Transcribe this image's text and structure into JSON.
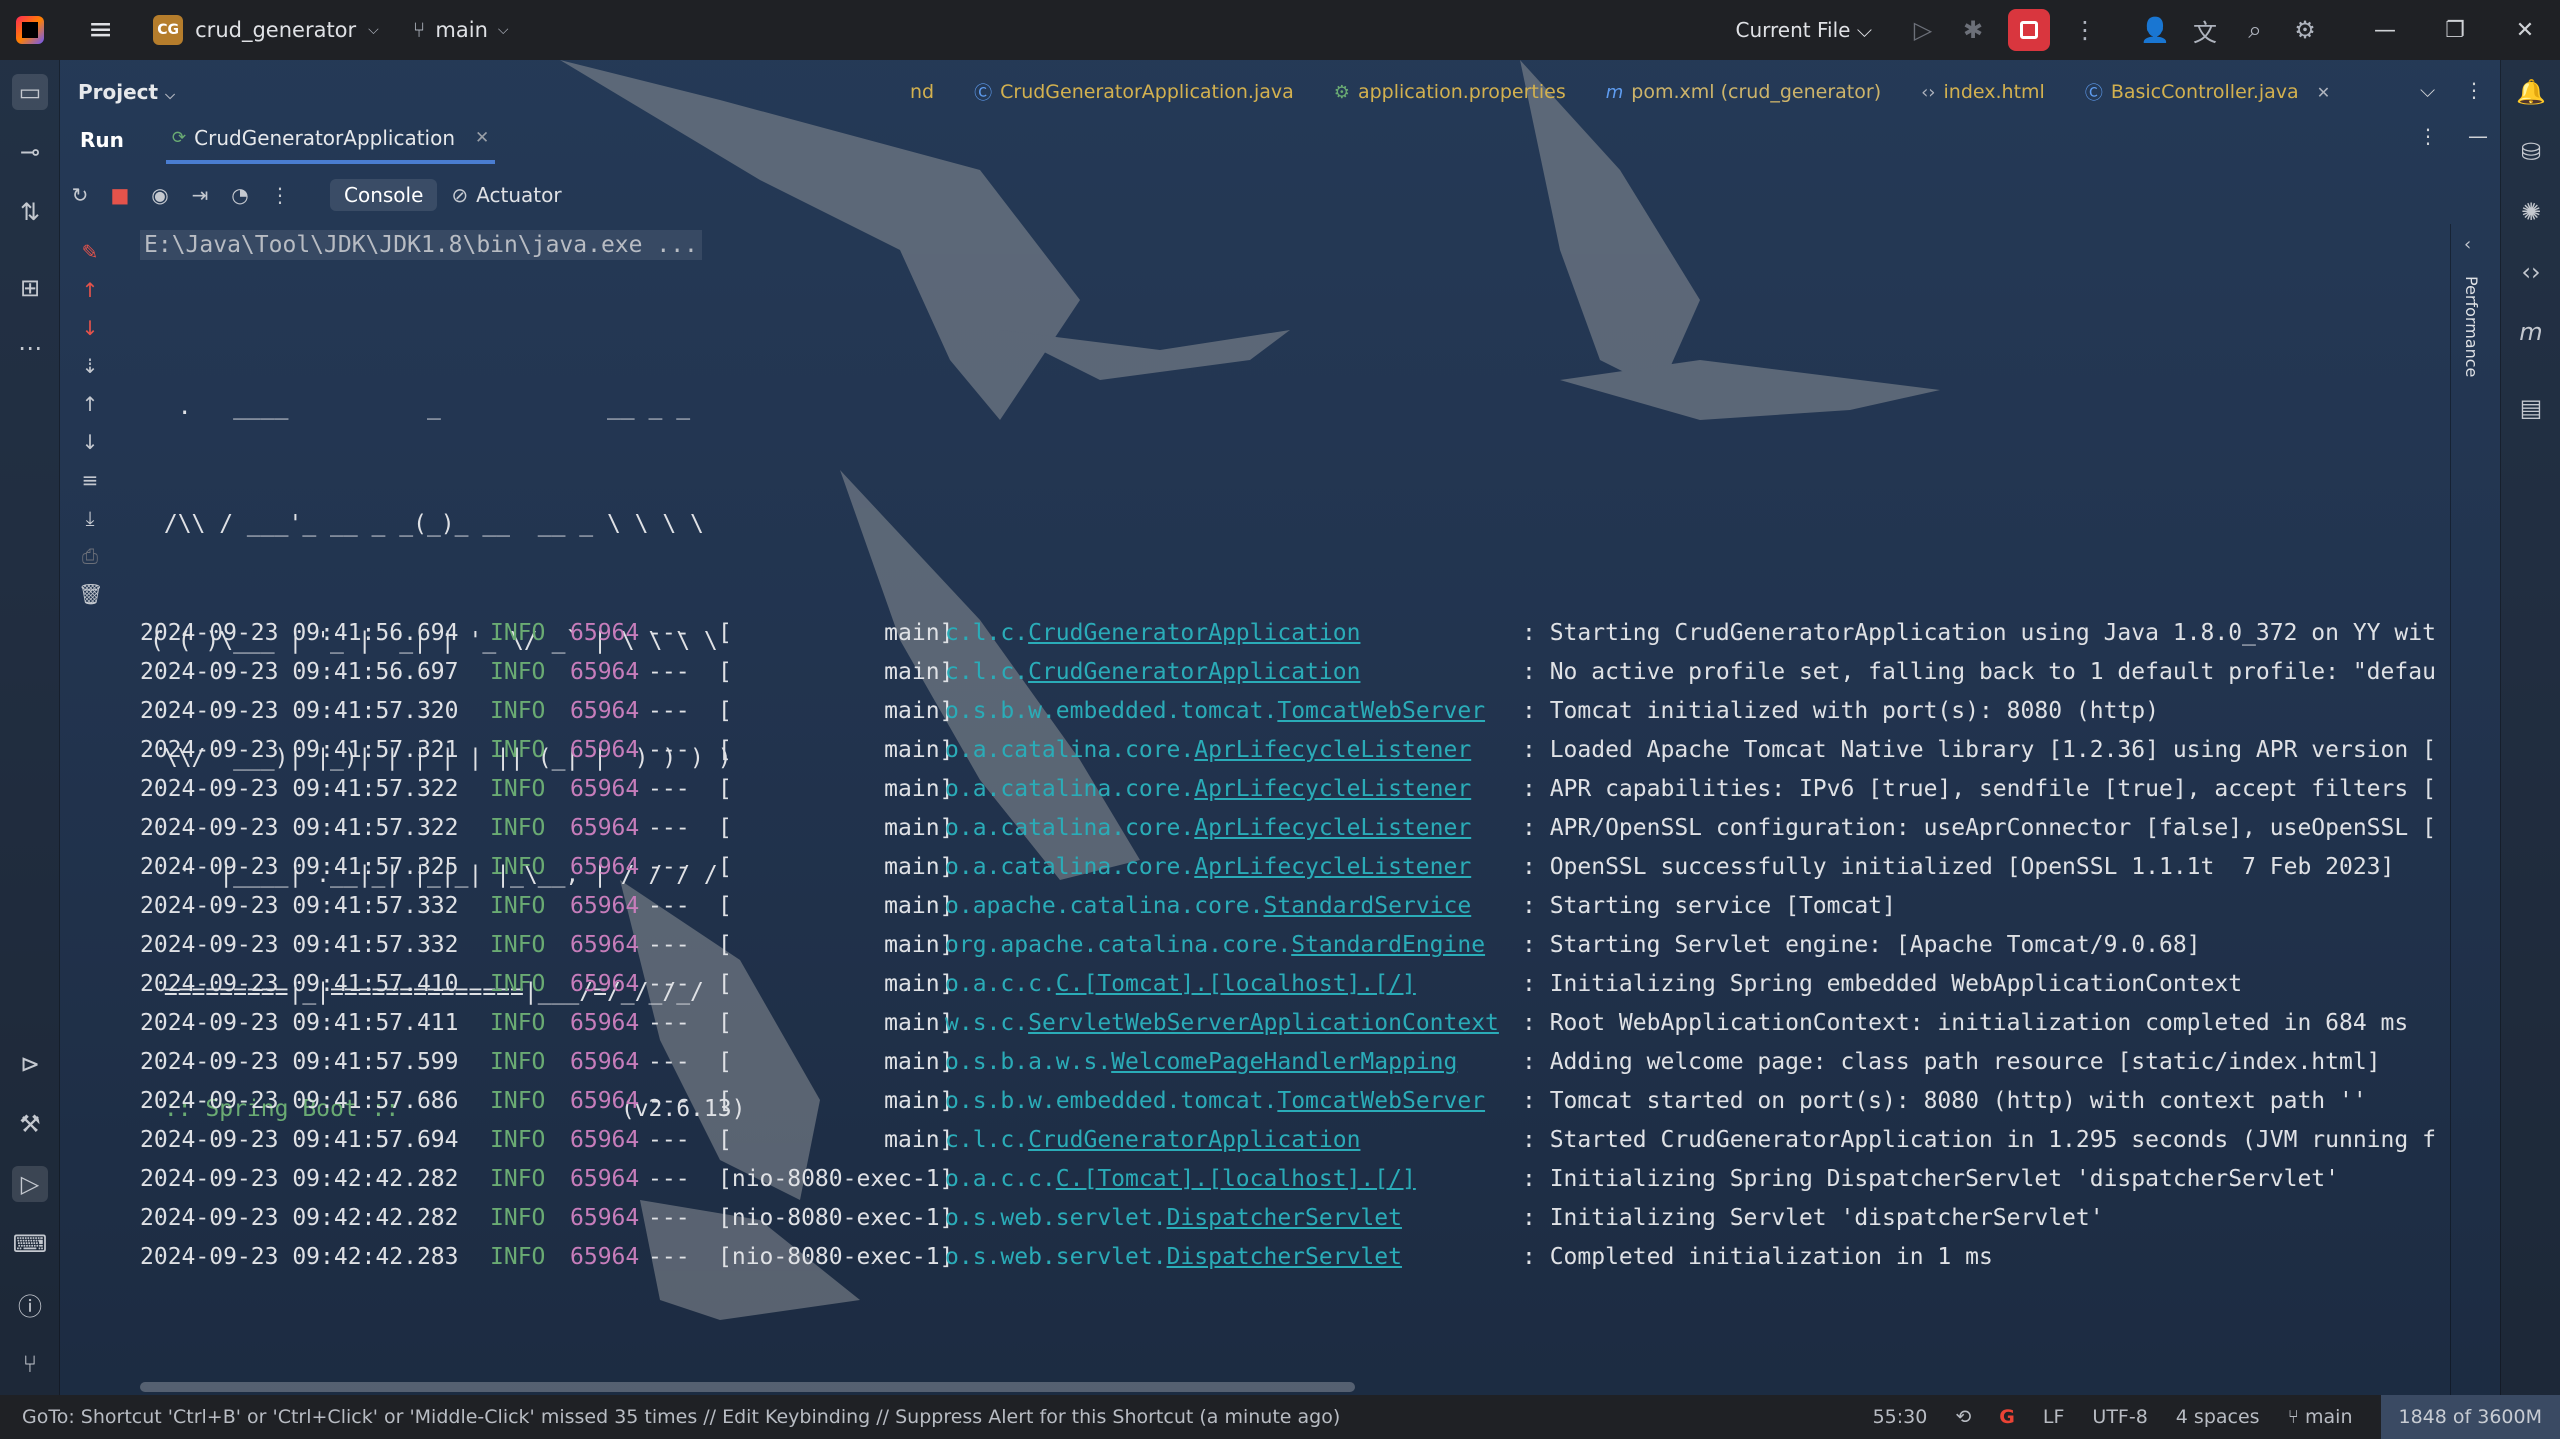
{
  "titlebar": {
    "project_badge": "CG",
    "project_name": "crud_generator",
    "branch": "main",
    "run_config": "Current File"
  },
  "project_panel": {
    "label": "Project"
  },
  "editor_tabs": [
    {
      "label": "nd",
      "type": "partial"
    },
    {
      "label": "CrudGeneratorApplication.java",
      "type": "java"
    },
    {
      "label": "application.properties",
      "type": "props"
    },
    {
      "label": "pom.xml (crud_generator)",
      "type": "pom"
    },
    {
      "label": "index.html",
      "type": "html"
    },
    {
      "label": "BasicController.java",
      "type": "java-active"
    }
  ],
  "run_panel": {
    "label": "Run",
    "tab": "CrudGeneratorApplication",
    "console_tab": "Console",
    "actuator_tab": "Actuator",
    "side_label": "Performance"
  },
  "console": {
    "command": "E:\\Java\\Tool\\JDK\\JDK1.8\\bin\\java.exe ...",
    "banner": [
      "  .   ____          _            __ _ _",
      " /\\\\ / ___'_ __ _ _(_)_ __  __ _ \\ \\ \\ \\",
      "( ( )\\___ | '_ | '_| | '_ \\/ _` | \\ \\ \\ \\",
      " \\\\/  ___)| |_)| | | | | || (_| |  ) ) ) )",
      "  '  |____| .__|_| |_|_| |_\\__, | / / / /",
      " =========|_|==============|___/=/_/_/_/"
    ],
    "banner_springboot": " :: Spring Boot ::",
    "banner_version": "(v2.6.13)",
    "logs": [
      {
        "date": "2024-09-23 09:41:56.694",
        "level": "INFO",
        "pid": "65964",
        "sep": "---",
        "thread": "[           main]",
        "logger_prefix": "c.l.c.",
        "logger_link": "CrudGeneratorApplication",
        "msg": ": Starting CrudGeneratorApplication using Java 1.8.0_372 on YY wit"
      },
      {
        "date": "2024-09-23 09:41:56.697",
        "level": "INFO",
        "pid": "65964",
        "sep": "---",
        "thread": "[           main]",
        "logger_prefix": "c.l.c.",
        "logger_link": "CrudGeneratorApplication",
        "msg": ": No active profile set, falling back to 1 default profile: \"defau"
      },
      {
        "date": "2024-09-23 09:41:57.320",
        "level": "INFO",
        "pid": "65964",
        "sep": "---",
        "thread": "[           main]",
        "logger_prefix": "o.s.b.w.embedded.tomcat.",
        "logger_link": "TomcatWebServer",
        "msg": ": Tomcat initialized with port(s): 8080 (http)"
      },
      {
        "date": "2024-09-23 09:41:57.321",
        "level": "INFO",
        "pid": "65964",
        "sep": "---",
        "thread": "[           main]",
        "logger_prefix": "o.a.catalina.core.",
        "logger_link": "AprLifecycleListener",
        "msg": ": Loaded Apache Tomcat Native library [1.2.36] using APR version ["
      },
      {
        "date": "2024-09-23 09:41:57.322",
        "level": "INFO",
        "pid": "65964",
        "sep": "---",
        "thread": "[           main]",
        "logger_prefix": "o.a.catalina.core.",
        "logger_link": "AprLifecycleListener",
        "msg": ": APR capabilities: IPv6 [true], sendfile [true], accept filters ["
      },
      {
        "date": "2024-09-23 09:41:57.322",
        "level": "INFO",
        "pid": "65964",
        "sep": "---",
        "thread": "[           main]",
        "logger_prefix": "o.a.catalina.core.",
        "logger_link": "AprLifecycleListener",
        "msg": ": APR/OpenSSL configuration: useAprConnector [false], useOpenSSL ["
      },
      {
        "date": "2024-09-23 09:41:57.325",
        "level": "INFO",
        "pid": "65964",
        "sep": "---",
        "thread": "[           main]",
        "logger_prefix": "o.a.catalina.core.",
        "logger_link": "AprLifecycleListener",
        "msg": ": OpenSSL successfully initialized [OpenSSL 1.1.1t  7 Feb 2023]"
      },
      {
        "date": "2024-09-23 09:41:57.332",
        "level": "INFO",
        "pid": "65964",
        "sep": "---",
        "thread": "[           main]",
        "logger_prefix": "o.apache.catalina.core.",
        "logger_link": "StandardService",
        "msg": ": Starting service [Tomcat]"
      },
      {
        "date": "2024-09-23 09:41:57.332",
        "level": "INFO",
        "pid": "65964",
        "sep": "---",
        "thread": "[           main]",
        "logger_prefix": "org.apache.catalina.core.",
        "logger_link": "StandardEngine",
        "msg": ": Starting Servlet engine: [Apache Tomcat/9.0.68]"
      },
      {
        "date": "2024-09-23 09:41:57.410",
        "level": "INFO",
        "pid": "65964",
        "sep": "---",
        "thread": "[           main]",
        "logger_prefix": "o.a.c.c.",
        "logger_link": "C.[Tomcat].[localhost].[/]",
        "msg": ": Initializing Spring embedded WebApplicationContext"
      },
      {
        "date": "2024-09-23 09:41:57.411",
        "level": "INFO",
        "pid": "65964",
        "sep": "---",
        "thread": "[           main]",
        "logger_prefix": "w.s.c.",
        "logger_link": "ServletWebServerApplicationContext",
        "msg": ": Root WebApplicationContext: initialization completed in 684 ms"
      },
      {
        "date": "2024-09-23 09:41:57.599",
        "level": "INFO",
        "pid": "65964",
        "sep": "---",
        "thread": "[           main]",
        "logger_prefix": "o.s.b.a.w.s.",
        "logger_link": "WelcomePageHandlerMapping",
        "msg": ": Adding welcome page: class path resource [static/index.html]"
      },
      {
        "date": "2024-09-23 09:41:57.686",
        "level": "INFO",
        "pid": "65964",
        "sep": "---",
        "thread": "[           main]",
        "logger_prefix": "o.s.b.w.embedded.tomcat.",
        "logger_link": "TomcatWebServer",
        "msg": ": Tomcat started on port(s): 8080 (http) with context path ''"
      },
      {
        "date": "2024-09-23 09:41:57.694",
        "level": "INFO",
        "pid": "65964",
        "sep": "---",
        "thread": "[           main]",
        "logger_prefix": "c.l.c.",
        "logger_link": "CrudGeneratorApplication",
        "msg": ": Started CrudGeneratorApplication in 1.295 seconds (JVM running f"
      },
      {
        "date": "2024-09-23 09:42:42.282",
        "level": "INFO",
        "pid": "65964",
        "sep": "---",
        "thread": "[nio-8080-exec-1]",
        "logger_prefix": "o.a.c.c.",
        "logger_link": "C.[Tomcat].[localhost].[/]",
        "msg": ": Initializing Spring DispatcherServlet 'dispatcherServlet'"
      },
      {
        "date": "2024-09-23 09:42:42.282",
        "level": "INFO",
        "pid": "65964",
        "sep": "---",
        "thread": "[nio-8080-exec-1]",
        "logger_prefix": "o.s.web.servlet.",
        "logger_link": "DispatcherServlet",
        "msg": ": Initializing Servlet 'dispatcherServlet'"
      },
      {
        "date": "2024-09-23 09:42:42.283",
        "level": "INFO",
        "pid": "65964",
        "sep": "---",
        "thread": "[nio-8080-exec-1]",
        "logger_prefix": "o.s.web.servlet.",
        "logger_link": "DispatcherServlet",
        "msg": ": Completed initialization in 1 ms"
      }
    ]
  },
  "statusbar": {
    "message": "GoTo: Shortcut 'Ctrl+B' or 'Ctrl+Click' or 'Middle-Click' missed 35 times // Edit Keybinding // Suppress Alert for this Shortcut (a minute ago)",
    "position": "55:30",
    "line_ending": "LF",
    "encoding": "UTF-8",
    "indent": "4 spaces",
    "branch": "main",
    "memory": "1848 of 3600M"
  },
  "colors": {
    "info": "#6aab73",
    "pid": "#c77dbb",
    "logger": "#2aacb8",
    "stop": "#d9363e",
    "tab_underline": "#4a7dd1"
  }
}
